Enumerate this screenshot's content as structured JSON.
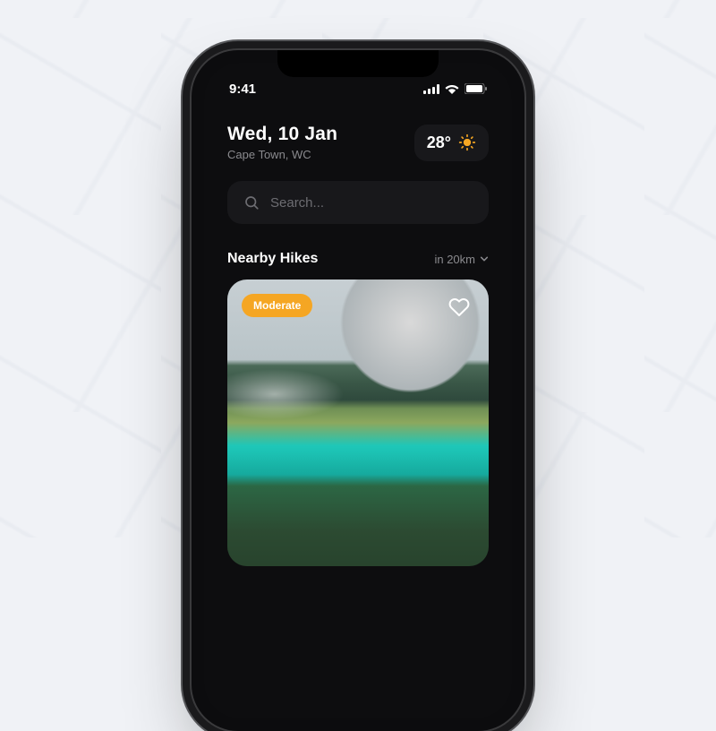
{
  "status": {
    "time": "9:41"
  },
  "header": {
    "date": "Wed, 10 Jan",
    "location": "Cape Town, WC",
    "temperature": "28°"
  },
  "search": {
    "placeholder": "Search..."
  },
  "section": {
    "title": "Nearby Hikes",
    "range_label": "in 20km"
  },
  "card": {
    "difficulty": "Moderate"
  },
  "colors": {
    "accent": "#f5a623"
  }
}
